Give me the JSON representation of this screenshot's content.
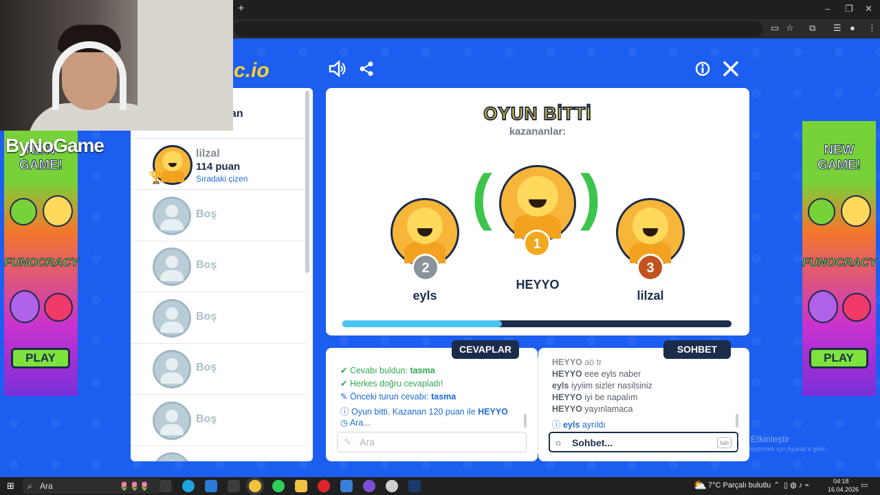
{
  "browser": {
    "new_tab_glyph": "+",
    "window_controls": [
      "–",
      "❐",
      "✕"
    ]
  },
  "game": {
    "logo_text": "c.io",
    "top_icons": [
      "speaker-icon",
      "share-icon",
      "info-icon",
      "close-icon"
    ],
    "players": [
      {
        "name": "lilzal",
        "score": "114 puan",
        "note": "Sıradaki çizen"
      },
      {
        "name": "Boş"
      },
      {
        "name": "Boş"
      },
      {
        "name": "Boş"
      },
      {
        "name": "Boş"
      },
      {
        "name": "Boş"
      }
    ],
    "partial_row_text": "an",
    "result": {
      "title": "OYUN BİTTİ",
      "subtitle": "kazananlar:",
      "first": {
        "name": "HEYYO",
        "rank": "1"
      },
      "second": {
        "name": "eyls",
        "rank": "2"
      },
      "third": {
        "name": "lilzal",
        "rank": "3"
      },
      "progress": 0.41
    },
    "answers": {
      "tab_label": "CEVAPLAR",
      "messages": [
        {
          "text": "Cevabı buldun: ",
          "bold": "tasma"
        },
        {
          "text": "Herkes doğru cevapladı!"
        },
        {
          "text": "Önceki turun cevabı: ",
          "bold": "tasma"
        },
        {
          "text": "Oyun bitti. Kazanan 120 puan ile ",
          "bold": "HEYYO"
        },
        {
          "text": "Ara..."
        }
      ],
      "input_placeholder": "Ara"
    },
    "chat": {
      "tab_label": "SOHBET",
      "messages": [
        {
          "user": "HEYYO",
          "text": "aö tr"
        },
        {
          "user": "HEYYO",
          "text": "eee eyls naber"
        },
        {
          "user": "eyls",
          "text": "iyyiim sizler nasilsiniz"
        },
        {
          "user": "HEYYO",
          "text": "iyi be napalım"
        },
        {
          "user": "HEYYO",
          "text": "yayınlamaca"
        },
        {
          "user": "eyls",
          "text": "ayrıldı"
        }
      ],
      "input_placeholder": "Sohbet...",
      "tab_hint": "tab"
    }
  },
  "ads": {
    "new_game": "NEW GAME!",
    "brand": "FUNOCRACY",
    "play": "PLAY"
  },
  "overlay": {
    "brand": "ByNoGame"
  },
  "watermark": {
    "line1": "Windows'u Etkinleştir",
    "line2": "Windows'u etkinleştirmek için Ayarlar'a gidin."
  },
  "taskbar": {
    "search": "Ara",
    "weather": "7°C  Parçalı bulutlu",
    "time": "04:18",
    "date": "16.04.2026"
  },
  "colors": {
    "page_bg": "#1b5ef0",
    "navy": "#1b2b4a",
    "gold": "#ffcf2e",
    "green": "#2fa84f",
    "blue": "#1b6bd6"
  }
}
